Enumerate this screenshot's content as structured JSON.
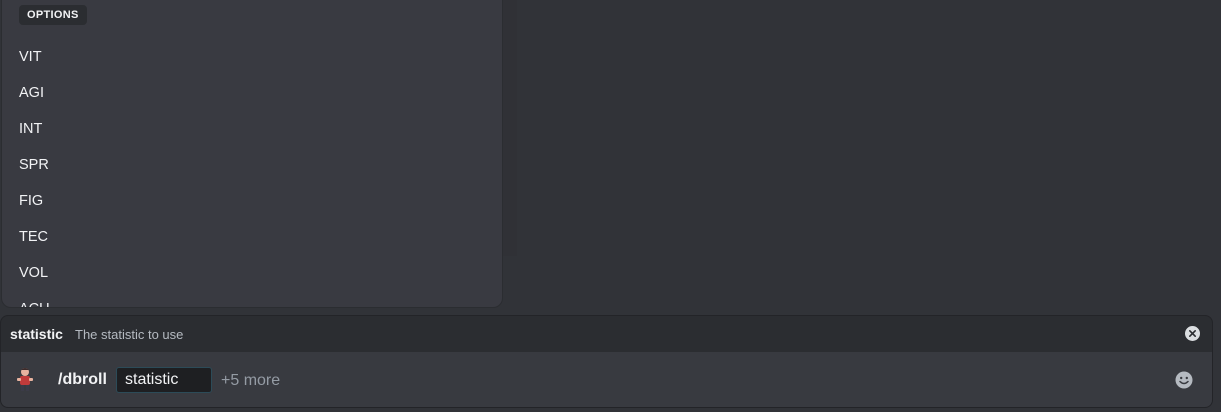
{
  "options": {
    "header": "OPTIONS",
    "items": [
      "VIT",
      "AGI",
      "INT",
      "SPR",
      "FIG",
      "TEC",
      "VOL",
      "ACU"
    ]
  },
  "hint": {
    "param_name": "statistic",
    "description": "The statistic to use"
  },
  "input": {
    "command": "/dbroll",
    "param_value": "statistic",
    "more_label": "+5 more"
  },
  "icons": {
    "hint_close": "close-circle-icon",
    "app_avatar": "bot-avatar-icon",
    "emoji": "smiley-icon"
  }
}
